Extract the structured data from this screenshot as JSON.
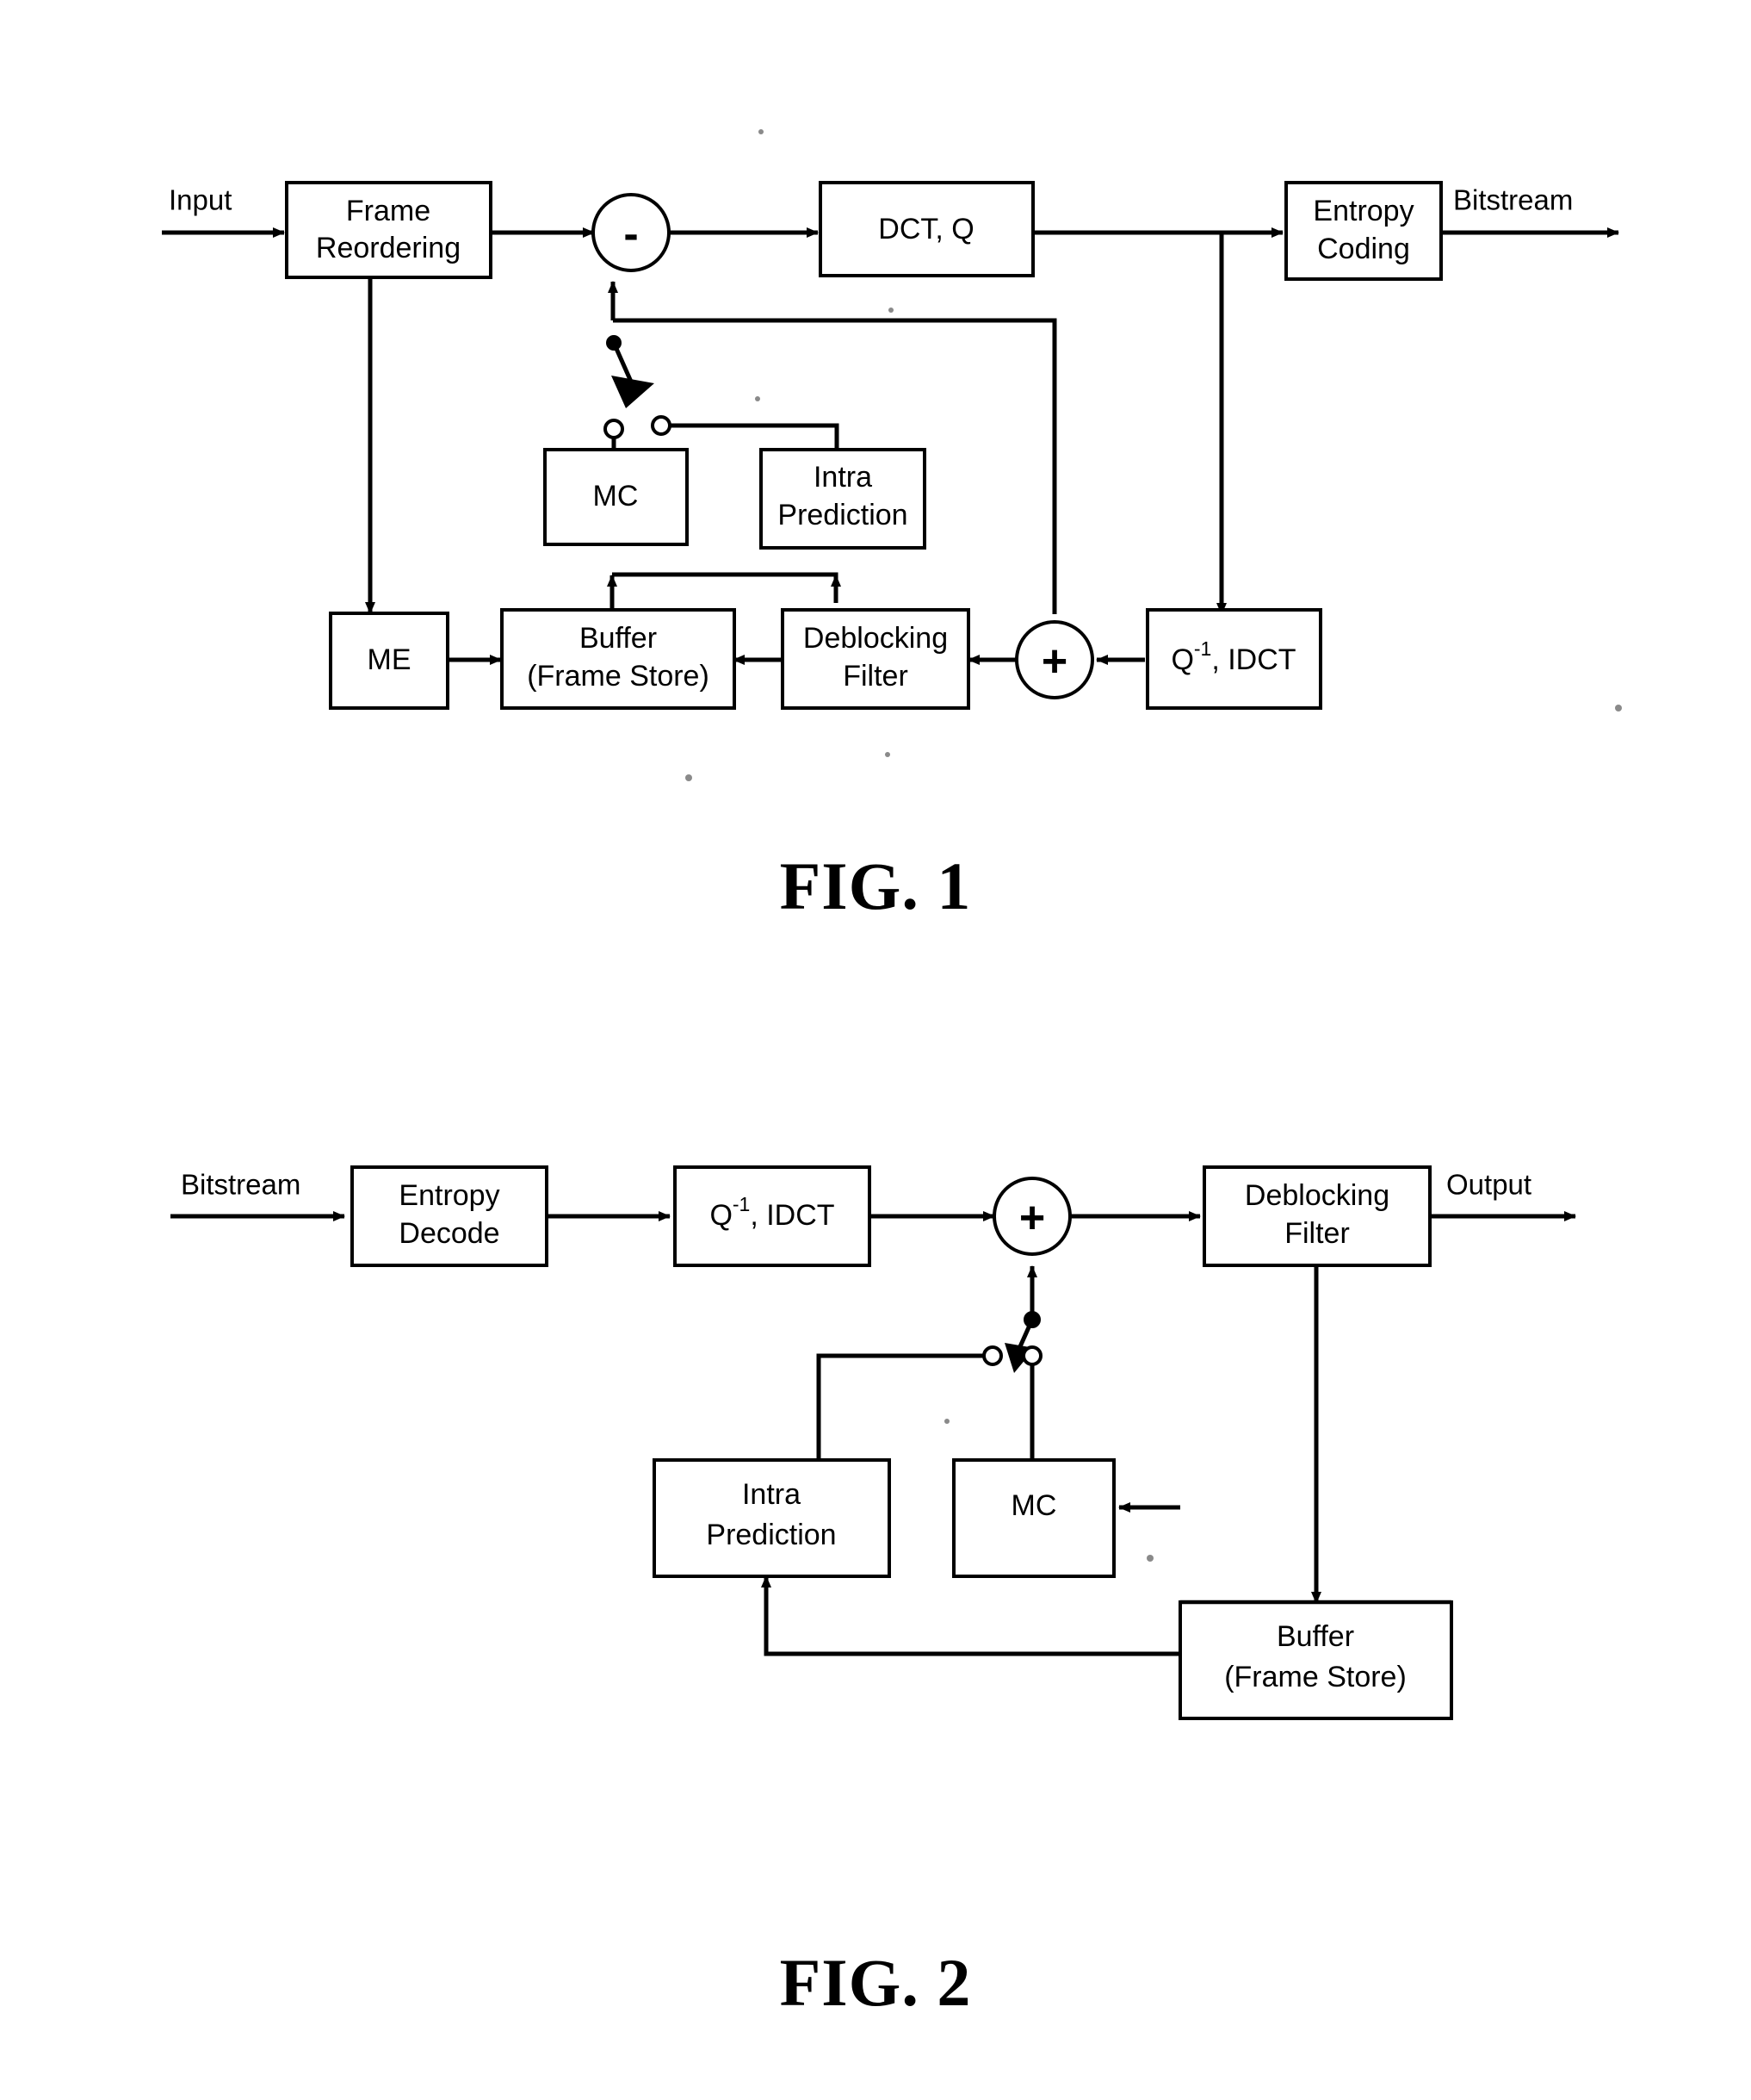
{
  "document": {
    "type": "patent-block-diagram",
    "background_color": "#ffffff",
    "ink_color": "#000000"
  },
  "figures": [
    {
      "id": "figure-1",
      "caption": "FIG. 1",
      "title": "Video encoder block diagram",
      "nodes": [
        {
          "id": "frame-reordering",
          "label_line_1": "Frame",
          "label_line_2": "Reordering",
          "shape": "rect"
        },
        {
          "id": "subtractor",
          "label_line_1": "-",
          "label_line_2": "",
          "shape": "circle"
        },
        {
          "id": "dct-q",
          "label_line_1": "DCT, Q",
          "label_line_2": "",
          "shape": "rect"
        },
        {
          "id": "entropy-coding",
          "label_line_1": "Entropy",
          "label_line_2": "Coding",
          "shape": "rect"
        },
        {
          "id": "mc",
          "label_line_1": "MC",
          "label_line_2": "",
          "shape": "rect"
        },
        {
          "id": "intra-prediction",
          "label_line_1": "Intra",
          "label_line_2": "Prediction",
          "shape": "rect"
        },
        {
          "id": "me",
          "label_line_1": "ME",
          "label_line_2": "",
          "shape": "rect"
        },
        {
          "id": "buffer",
          "label_line_1": "Buffer",
          "label_line_2": "(Frame Store)",
          "shape": "rect"
        },
        {
          "id": "deblocking-filter",
          "label_line_1": "Deblocking",
          "label_line_2": "Filter",
          "shape": "rect"
        },
        {
          "id": "adder",
          "label_line_1": "+",
          "label_line_2": "",
          "shape": "circle"
        },
        {
          "id": "inv-q-idct",
          "label_prefix": "Q",
          "label_sup": "-1",
          "label_suffix": ", IDCT",
          "shape": "rect"
        }
      ],
      "edge_labels": {
        "input": "Input",
        "bitstream": "Bitstream"
      },
      "switch": {
        "name": "prediction-mode-switch",
        "position": "connected-to-mc",
        "terminals": [
          "MC",
          "Intra Prediction"
        ]
      }
    },
    {
      "id": "figure-2",
      "caption": "FIG. 2",
      "title": "Video decoder block diagram",
      "nodes": [
        {
          "id": "entropy-decode",
          "label_line_1": "Entropy",
          "label_line_2": "Decode",
          "shape": "rect"
        },
        {
          "id": "inv-q-idct",
          "label_prefix": "Q",
          "label_sup": "-1",
          "label_suffix": ", IDCT",
          "shape": "rect"
        },
        {
          "id": "adder",
          "label_line_1": "+",
          "label_line_2": "",
          "shape": "circle"
        },
        {
          "id": "deblocking-filter",
          "label_line_1": "Deblocking",
          "label_line_2": "Filter",
          "shape": "rect"
        },
        {
          "id": "intra-prediction",
          "label_line_1": "Intra",
          "label_line_2": "Prediction",
          "shape": "rect"
        },
        {
          "id": "mc",
          "label_line_1": "MC",
          "label_line_2": "",
          "shape": "rect"
        },
        {
          "id": "buffer",
          "label_line_1": "Buffer",
          "label_line_2": "(Frame Store)",
          "shape": "rect"
        }
      ],
      "edge_labels": {
        "bitstream": "Bitstream",
        "output": "Output"
      },
      "switch": {
        "name": "prediction-mode-switch",
        "position": "between-intra-and-mc",
        "terminals": [
          "Intra Prediction",
          "MC"
        ]
      }
    }
  ]
}
